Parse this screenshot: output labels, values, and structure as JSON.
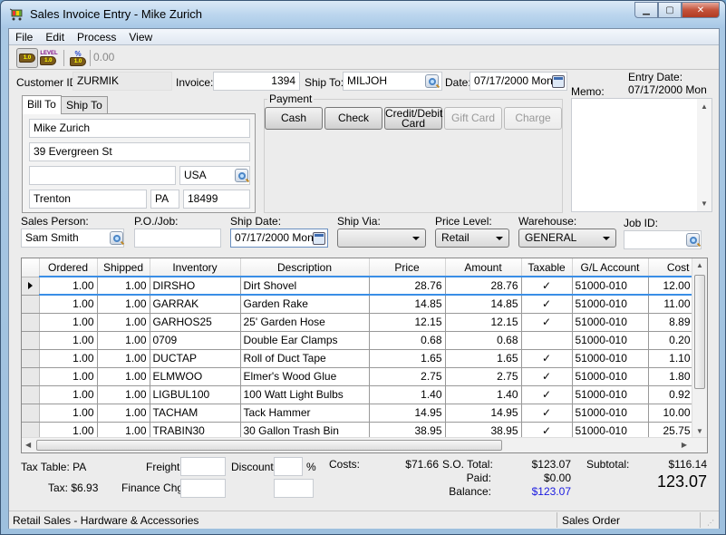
{
  "window": {
    "title": "Sales Invoice Entry - Mike Zurich",
    "minimize_label": "minimize",
    "maximize_label": "maximize",
    "close_label": "close"
  },
  "menu": [
    "File",
    "Edit",
    "Process",
    "View"
  ],
  "toolbar": {
    "level_label": "LEVEL",
    "value": "0.00"
  },
  "header": {
    "customer_id_label": "Customer ID:",
    "customer_id": "ZURMIK",
    "invoice_label": "Invoice:",
    "invoice": "1394",
    "ship_to_label": "Ship To:",
    "ship_to": "MILJOH",
    "date_label": "Date:",
    "date": "07/17/2000 Mon",
    "entry_date_label": "Entry Date:",
    "entry_date": "07/17/2000 Mon",
    "memo_label": "Memo:",
    "memo": ""
  },
  "address_tabs": [
    "Bill To",
    "Ship To"
  ],
  "bill_to": {
    "name": "Mike Zurich",
    "street": "39 Evergreen St",
    "line3": "",
    "country": "USA",
    "city": "Trenton",
    "state": "PA",
    "zip": "18499"
  },
  "payment": {
    "label": "Payment",
    "buttons": [
      {
        "label": "Cash",
        "enabled": true
      },
      {
        "label": "Check",
        "enabled": true
      },
      {
        "label": "Credit/Debit",
        "label2": "Card",
        "enabled": true
      },
      {
        "label": "Gift Card",
        "enabled": false
      },
      {
        "label": "Charge",
        "enabled": false
      }
    ]
  },
  "order": {
    "sales_person_label": "Sales Person:",
    "sales_person": "Sam Smith",
    "po_job_label": "P.O./Job:",
    "po_job": "",
    "ship_date_label": "Ship Date:",
    "ship_date": "07/17/2000 Mon",
    "ship_via_label": "Ship Via:",
    "ship_via": "",
    "price_level_label": "Price Level:",
    "price_level": "Retail",
    "warehouse_label": "Warehouse:",
    "warehouse": "GENERAL",
    "job_id_label": "Job ID:",
    "job_id": ""
  },
  "grid": {
    "columns": [
      "Ordered",
      "Shipped",
      "Inventory",
      "Description",
      "Price",
      "Amount",
      "Taxable",
      "G/L Account",
      "Cost"
    ],
    "rows": [
      [
        "1.00",
        "1.00",
        "DIRSHO",
        "Dirt Shovel",
        "28.76",
        "28.76",
        "✓",
        "51000-010",
        "12.00"
      ],
      [
        "1.00",
        "1.00",
        "GARRAK",
        "Garden Rake",
        "14.85",
        "14.85",
        "✓",
        "51000-010",
        "11.00"
      ],
      [
        "1.00",
        "1.00",
        "GARHOS25",
        "25' Garden Hose",
        "12.15",
        "12.15",
        "✓",
        "51000-010",
        "8.89"
      ],
      [
        "1.00",
        "1.00",
        "0709",
        "Double Ear Clamps",
        "0.68",
        "0.68",
        "",
        "51000-010",
        "0.20"
      ],
      [
        "1.00",
        "1.00",
        "DUCTAP",
        "Roll of Duct Tape",
        "1.65",
        "1.65",
        "✓",
        "51000-010",
        "1.10"
      ],
      [
        "1.00",
        "1.00",
        "ELMWOO",
        "Elmer's Wood Glue",
        "2.75",
        "2.75",
        "✓",
        "51000-010",
        "1.80"
      ],
      [
        "1.00",
        "1.00",
        "LIGBUL100",
        "100 Watt Light Bulbs",
        "1.40",
        "1.40",
        "✓",
        "51000-010",
        "0.92"
      ],
      [
        "1.00",
        "1.00",
        "TACHAM",
        "Tack Hammer",
        "14.95",
        "14.95",
        "✓",
        "51000-010",
        "10.00"
      ],
      [
        "1.00",
        "1.00",
        "TRABIN30",
        "30 Gallon Trash Bin",
        "38.95",
        "38.95",
        "✓",
        "51000-010",
        "25.75"
      ]
    ]
  },
  "totals": {
    "tax_table_label": "Tax Table: PA",
    "tax_label": "Tax: $6.93",
    "freight_label": "Freight:",
    "freight": "",
    "finance_chg_label": "Finance Chg:",
    "finance_chg": "",
    "discount_label": "Discount:",
    "discount": "",
    "discount_amount": "",
    "percent_sign": "%",
    "costs_label": "Costs:",
    "costs": "$71.66",
    "so_total_label": "S.O. Total:",
    "so_total": "$123.07",
    "paid_label": "Paid:",
    "paid": "$0.00",
    "balance_label": "Balance:",
    "balance": "$123.07",
    "subtotal_label": "Subtotal:",
    "subtotal": "$116.14",
    "grand_total": "123.07"
  },
  "status": {
    "left": "Retail Sales - Hardware & Accessories",
    "right": "Sales Order"
  },
  "colors": {
    "accent_blue": "#3a8ee6",
    "balance_blue": "#1a1ae0"
  }
}
